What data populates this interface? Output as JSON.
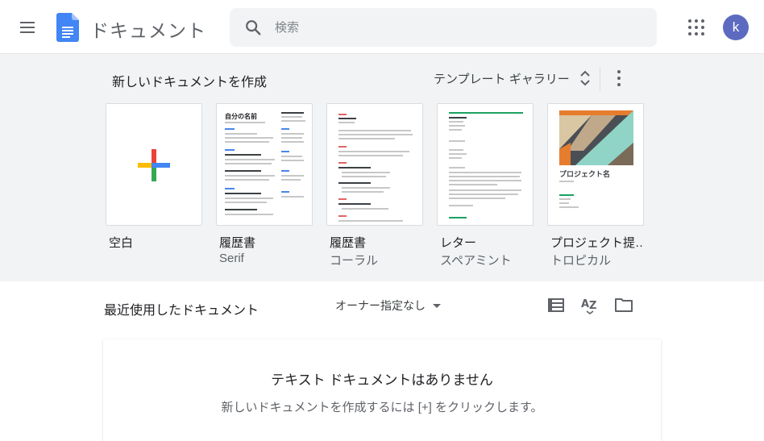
{
  "header": {
    "app_title": "ドキュメント",
    "search_placeholder": "検索",
    "avatar_letter": "k"
  },
  "gallery": {
    "title": "新しいドキュメントを作成",
    "toggle_label": "テンプレート ギャラリー",
    "templates": [
      {
        "name": "空白",
        "sub": ""
      },
      {
        "name": "履歴書",
        "sub": "Serif"
      },
      {
        "name": "履歴書",
        "sub": "コーラル"
      },
      {
        "name": "レター",
        "sub": "スペアミント"
      },
      {
        "name": "プロジェクト提…",
        "sub": "トロピカル"
      }
    ],
    "thumb_text": {
      "serif_name": "自分の名前",
      "tropical_title": "プロジェクト名"
    }
  },
  "recent": {
    "title": "最近使用したドキュメント",
    "owner_filter": "オーナー指定なし",
    "empty_title": "テキスト ドキュメントはありません",
    "empty_hint": "新しいドキュメントを作成するには [+] をクリックします。"
  },
  "colors": {
    "docs_blue": "#4285f4",
    "avatar": "#5c6bc0",
    "gallery_bg": "#f1f3f4",
    "coral": "#e06666",
    "spearmint": "#1aa260"
  },
  "icons": [
    "menu-icon",
    "docs-logo-icon",
    "search-icon",
    "apps-icon",
    "unfold-icon",
    "more-vert-icon",
    "plus-icon",
    "caret-down-icon",
    "view-list-icon",
    "sort-az-icon",
    "folder-icon"
  ]
}
